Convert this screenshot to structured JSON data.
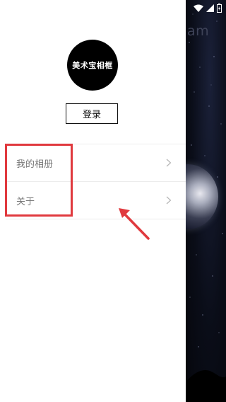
{
  "background_app": {
    "title_fragment": "am"
  },
  "drawer": {
    "avatar_text": "美术宝相框",
    "login_label": "登录",
    "menu": [
      {
        "label": "我的相册",
        "icon": "chevron-right-icon"
      },
      {
        "label": "关于",
        "icon": "chevron-right-icon"
      }
    ]
  },
  "status_bar": {
    "icons": [
      "wifi-icon",
      "signal-icon",
      "battery-icon"
    ]
  },
  "colors": {
    "highlight": "#e0393e",
    "avatar_bg": "#000000",
    "menu_text": "#777777",
    "night_bg": "#0a0d18"
  }
}
